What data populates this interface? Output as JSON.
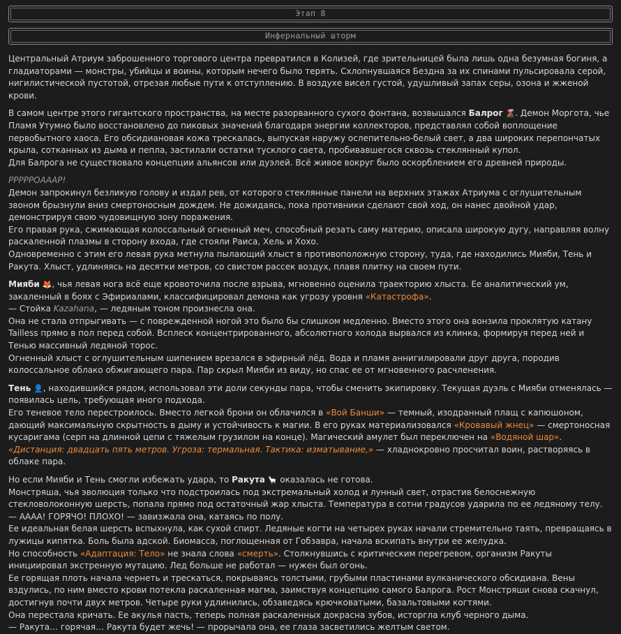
{
  "banners": {
    "stage": "Этап 8",
    "title": "Инфернальный шторм"
  },
  "paragraphs": [
    [
      [
        {
          "t": "Центральный Атриум заброшенного торгового центра превратился в Колизей, где зрительницей была лишь одна безумная богиня, а гладиаторами — монстры, убийцы и воины, которым нечего было терять. Схлопнувшаяся Бездна за их спинами пульсировала серой, нигилистической пустотой, отрезая любые пути к отступлению. В воздухе висел густой, удушливый запах серы, озона и жженой крови."
        }
      ]
    ],
    [
      [
        {
          "t": "В самом центре этого гигантского пространства, на месте разорванного сухого фонтана, возвышался "
        },
        {
          "t": "Балрог",
          "s": "bold"
        },
        {
          "t": " ",
          "s": ""
        },
        {
          "t": "🌋",
          "s": "emoji"
        },
        {
          "t": ". Демон Моргота, чье Пламя Утумно было восстановлено до пиковых значений благодаря энергии коллекторов, представлял собой воплощение первобытного хаоса. Его обсидиановая кожа трескалась, выпуская наружу ослепительно-белый свет, а два широких перепончатых крыла, сотканных из дыма и пепла, застилали остатки тусклого света, пробивавшегося сквозь стеклянный купол."
        }
      ],
      [
        {
          "t": "Для Балрога не существовало концепции альянсов или дуэлей. Всё живое вокруг было оскорблением его древней природы."
        }
      ]
    ],
    [
      [
        {
          "t": "РРРРРОАААР!",
          "s": "ital"
        }
      ],
      [
        {
          "t": "Демон запрокинул безликую голову и издал рев, от которого стеклянные панели на верхних этажах Атриума с оглушительным звоном брызнули вниз смертоносным дождем. Не дожидаясь, пока противники сделают свой ход, он нанес двойной удар, демонстрируя свою чудовищную зону поражения."
        }
      ],
      [
        {
          "t": "Его правая рука, сжимающая колоссальный огненный меч, способный резать саму материю, описала широкую дугу, направляя волну раскаленной плазмы в сторону входа, где стояли Раиса, Хель и Хохо."
        }
      ],
      [
        {
          "t": "Одновременно с этим его левая рука метнула пылающий хлыст в противоположную сторону, туда, где находились Мияби, Тень и Ракута. Хлыст, удлиняясь на десятки метров, со свистом рассек воздух, плавя плитку на своем пути."
        }
      ]
    ],
    [
      [
        {
          "t": "Мияби",
          "s": "bold"
        },
        {
          "t": " "
        },
        {
          "t": "🦊",
          "s": "emoji"
        },
        {
          "t": ", чья левая нога всё еще кровоточила после взрыва, мгновенно оценила траекторию хлыста. Ее аналитический ум, закаленный в боях с Эфириалами, классифицировал демона как угрозу уровня "
        },
        {
          "t": "«Катастрофа»",
          "s": "orange"
        },
        {
          "t": "."
        }
      ],
      [
        {
          "t": "— Стойка "
        },
        {
          "t": "Kazahana",
          "s": "ital"
        },
        {
          "t": ", — ледяным тоном произнесла она."
        }
      ],
      [
        {
          "t": "Она не стала отпрыгивать — с поврежденной ногой это было бы слишком медленно. Вместо этого она вонзила проклятую катану Tailless прямо в пол перед собой. Всплеск концентрированного, абсолютного холода вырвался из клинка, формируя перед ней и Тенью массивный ледяной торос."
        }
      ],
      [
        {
          "t": "Огненный хлыст с оглушительным шипением врезался в эфирный лёд. Вода и пламя аннигилировали друг друга, породив колоссальное облако обжигающего пара. Пар скрыл Мияби из виду, но спас ее от мгновенного расчленения."
        }
      ]
    ],
    [
      [
        {
          "t": "Тень",
          "s": "bold"
        },
        {
          "t": " "
        },
        {
          "t": "👤",
          "s": "emoji"
        },
        {
          "t": ", находившийся рядом, использовал эти доли секунды пара, чтобы сменить экипировку. Текущая дуэль с Мияби отменялась — появилась цель, требующая иного подхода."
        }
      ],
      [
        {
          "t": "Его теневое тело перестроилось. Вместо легкой брони он облачился в "
        },
        {
          "t": "«Вой Банши»",
          "s": "orange"
        },
        {
          "t": " — темный, изодранный плащ с капюшоном, дающий максимальную скрытность в дыму и устойчивость к магии. В его руках материализовался "
        },
        {
          "t": "«Кровавый жнец»",
          "s": "orange"
        },
        {
          "t": " — смертоносная кусаригама (серп на длинной цепи с тяжелым грузилом на конце). Магический амулет был переключен на "
        },
        {
          "t": "«Водяной шар»",
          "s": "orange"
        },
        {
          "t": "."
        }
      ],
      [
        {
          "t": "«Дистанция: двадцать пять метров. Угроза: термальная. Тактика: изматывание,»",
          "s": "orange-it"
        },
        {
          "t": " — хладнокровно просчитал воин, растворяясь в облаке пара."
        }
      ]
    ],
    [
      [
        {
          "t": "Но если Мияби и Тень смогли избежать удара, то "
        },
        {
          "t": "Ракута",
          "s": "bold"
        },
        {
          "t": " "
        },
        {
          "t": "🦙",
          "s": "emoji"
        },
        {
          "t": " оказалась не готова."
        }
      ],
      [
        {
          "t": "Монстряша, чья эволюция только что подстроилась под экстремальный холод и лунный свет, отрастив белоснежную стекловолоконную шерсть, попала прямо под остаточный жар хлыста. Температура в сотни градусов ударила по ее ледяному телу."
        }
      ],
      [
        {
          "t": "— АААА! ГОРЯЧО! ПЛОХО! — завизжала она, катаясь по полу."
        }
      ],
      [
        {
          "t": "Ее идеальная белая шерсть вспыхнула, как сухой спирт. Ледяные когти на четырех руках начали стремительно таять, превращаясь в лужицы кипятка. Боль была адской. Биомасса, поглощенная от Гобзавра, начала вскипать внутри ее желудка."
        }
      ],
      [
        {
          "t": "Но способность "
        },
        {
          "t": "«Адаптация: Тело»",
          "s": "orange"
        },
        {
          "t": " не знала слова "
        },
        {
          "t": "«смерть»",
          "s": "orange"
        },
        {
          "t": ". Столкнувшись с критическим перегревом, организм Ракуты инициировал экстренную мутацию. Лед больше не работал — нужен был огонь."
        }
      ],
      [
        {
          "t": "Ее горящая плоть начала чернеть и трескаться, покрываясь толстыми, грубыми пластинами вулканического обсидиана. Вены вздулись, по ним вместо крови потекла раскаленная магма, заимствуя концепцию самого Балрога. Рост Монстряши снова скачнул, достигнув почти двух метров. Четыре руки удлинились, обзаведясь крючковатыми, базальтовыми когтями."
        }
      ],
      [
        {
          "t": "Она перестала кричать. Ее акулья пасть, теперь полная раскаленных докрасна зубов, исторгла клуб черного дыма."
        }
      ],
      [
        {
          "t": "— Ракута… горячая… Ракута будет жечь! — прорычала она, ее глаза засветились желтым светом."
        }
      ]
    ]
  ]
}
